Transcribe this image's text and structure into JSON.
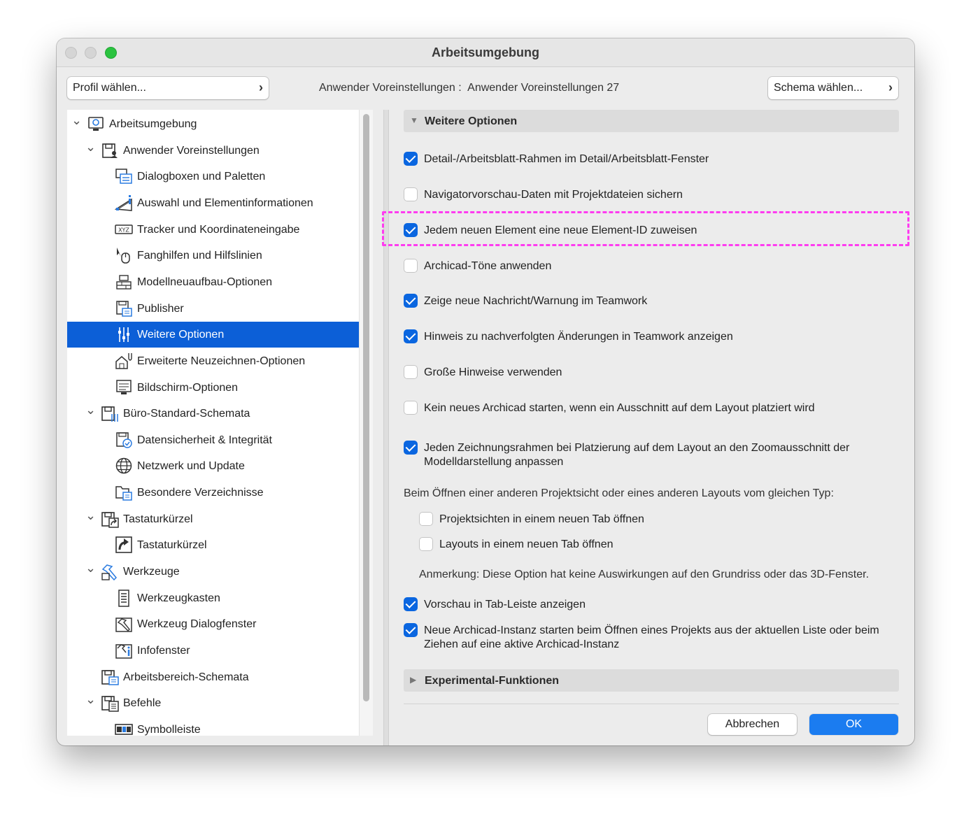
{
  "window": {
    "title": "Arbeitsumgebung"
  },
  "header": {
    "profile_button": "Profil wählen...",
    "current_label": "Anwender Voreinstellungen :",
    "current_value": "Anwender Voreinstellungen 27",
    "schema_button": "Schema wählen..."
  },
  "tree": {
    "items": [
      {
        "label": "Arbeitsumgebung",
        "level": 0,
        "expanded": true,
        "icon": "workspace-icon"
      },
      {
        "label": "Anwender Voreinstellungen",
        "level": 1,
        "expanded": true,
        "icon": "user-preferences-icon"
      },
      {
        "label": "Dialogboxen und Paletten",
        "level": 2,
        "icon": "dialog-palettes-icon"
      },
      {
        "label": "Auswahl und Elementinformationen",
        "level": 2,
        "icon": "selection-info-icon"
      },
      {
        "label": "Tracker und Koordinateneingabe",
        "level": 2,
        "icon": "xyz-tracker-icon"
      },
      {
        "label": "Fanghilfen und Hilfslinien",
        "level": 2,
        "icon": "snap-guides-icon"
      },
      {
        "label": "Modellneuaufbau-Optionen",
        "level": 2,
        "icon": "model-rebuild-icon"
      },
      {
        "label": "Publisher",
        "level": 2,
        "icon": "publisher-icon"
      },
      {
        "label": "Weitere Optionen",
        "level": 2,
        "icon": "more-options-icon",
        "selected": true
      },
      {
        "label": "Erweiterte Neuzeichnen-Optionen",
        "level": 2,
        "icon": "redraw-options-icon"
      },
      {
        "label": "Bildschirm-Optionen",
        "level": 2,
        "icon": "screen-options-icon"
      },
      {
        "label": "Büro-Standard-Schemata",
        "level": 1,
        "expanded": true,
        "icon": "office-standard-icon"
      },
      {
        "label": "Datensicherheit & Integrität",
        "level": 2,
        "icon": "data-safety-icon"
      },
      {
        "label": "Netzwerk und Update",
        "level": 2,
        "icon": "globe-icon"
      },
      {
        "label": "Besondere Verzeichnisse",
        "level": 2,
        "icon": "special-folders-icon"
      },
      {
        "label": "Tastaturkürzel",
        "level": 1,
        "expanded": true,
        "icon": "shortcuts-scheme-icon"
      },
      {
        "label": "Tastaturkürzel",
        "level": 2,
        "icon": "shortcut-arrow-icon"
      },
      {
        "label": "Werkzeuge",
        "level": 1,
        "expanded": true,
        "icon": "tools-icon"
      },
      {
        "label": "Werkzeugkasten",
        "level": 2,
        "icon": "toolbox-icon"
      },
      {
        "label": "Werkzeug Dialogfenster",
        "level": 2,
        "icon": "tool-dialog-icon"
      },
      {
        "label": "Infofenster",
        "level": 2,
        "icon": "info-box-icon"
      },
      {
        "label": "Arbeitsbereich-Schemata",
        "level": 1,
        "icon": "workspace-scheme-icon"
      },
      {
        "label": "Befehle",
        "level": 1,
        "expanded": true,
        "icon": "commands-icon"
      },
      {
        "label": "Symbolleiste",
        "level": 2,
        "icon": "toolbar-icon"
      }
    ]
  },
  "panel": {
    "section_title": "Weitere Optionen",
    "options": [
      {
        "label": "Detail-/Arbeitsblatt-Rahmen im Detail/Arbeitsblatt-Fenster",
        "checked": true
      },
      {
        "label": "Navigatorvorschau-Daten mit Projektdateien sichern",
        "checked": false
      },
      {
        "label": "Jedem neuen Element eine neue Element-ID zuweisen",
        "checked": true
      },
      {
        "label": "Archicad-Töne anwenden",
        "checked": false
      },
      {
        "label": "Zeige neue Nachricht/Warnung im Teamwork",
        "checked": true
      },
      {
        "label": "Hinweis zu nachverfolgten Änderungen in Teamwork anzeigen",
        "checked": true
      },
      {
        "label": "Große Hinweise verwenden",
        "checked": false
      },
      {
        "label": "Kein neues Archicad starten, wenn ein Ausschnitt auf dem Layout platziert wird",
        "checked": false
      },
      {
        "label": "Jeden Zeichnungsrahmen bei Platzierung auf dem Layout an den Zoomausschnitt der Modelldarstellung anpassen",
        "checked": true
      }
    ],
    "open_label": "Beim Öffnen einer anderen Projektsicht oder eines anderen Layouts vom gleichen Typ:",
    "sub_options": [
      {
        "label": "Projektsichten in einem neuen Tab öffnen",
        "checked": false
      },
      {
        "label": "Layouts in einem neuen Tab öffnen",
        "checked": false
      }
    ],
    "note": "Anmerkung: Diese Option hat keine Auswirkungen auf den Grundriss oder das 3D-Fenster.",
    "more_options": [
      {
        "label": "Vorschau in Tab-Leiste anzeigen",
        "checked": true
      },
      {
        "label": "Neue Archicad-Instanz starten beim Öffnen eines Projekts aus der aktuellen Liste oder beim Ziehen auf eine aktive Archicad-Instanz",
        "checked": true
      }
    ],
    "experimental_title": "Experimental-Funktionen"
  },
  "footer": {
    "cancel": "Abbrechen",
    "ok": "OK"
  },
  "colors": {
    "accent": "#0c5fd7",
    "highlight": "#ff3cf0",
    "ok_button": "#1b7cf0"
  }
}
